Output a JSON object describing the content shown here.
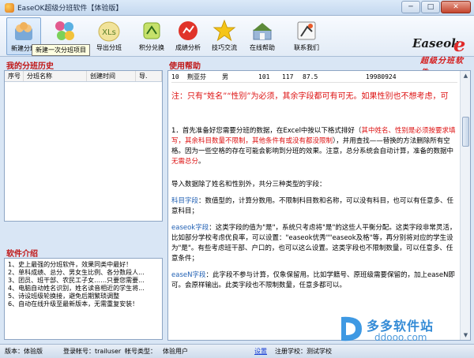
{
  "window": {
    "title": "EaseOK超级分班软件【体验版】",
    "controls": [
      "─",
      "□",
      "✕"
    ]
  },
  "toolbar": {
    "items": [
      {
        "label": "新建分班",
        "icon": "new-class-icon"
      },
      {
        "label": "",
        "icon": "open-bubbles-icon"
      },
      {
        "label": "导出分班",
        "icon": "xls-export-icon"
      },
      {
        "label": "积分兑换",
        "icon": "points-exchange-icon"
      },
      {
        "label": "成绩分析",
        "icon": "grade-analysis-icon"
      },
      {
        "label": "技巧交流",
        "icon": "star-tips-icon"
      },
      {
        "label": "在线帮助",
        "icon": "online-help-icon"
      },
      {
        "label": "联系我们",
        "icon": "contact-icon"
      }
    ],
    "tooltip": "新建一次分班项目"
  },
  "brand": {
    "name": "Easeok",
    "mark": "e",
    "tagline": "超级分班软件"
  },
  "history": {
    "heading": "我的分班历史",
    "columns": [
      "序号",
      "分班名称",
      "创建时间",
      "导."
    ]
  },
  "intro": {
    "heading": "软件介绍",
    "items": [
      "1、史上最强的分班软件，效果同类中最好！",
      "2、单科成绩、总分、男女生比例、各分数段人...",
      "3、团员、班干部、农民工子女……只要您需要...",
      "4、电脑自动姓名识别，姓名读音相近的学生将...",
      "5、诗设班级轮换接，避免后期繁琐调整",
      "6、自动在线升级至最新版本，无需重复安装！"
    ]
  },
  "help": {
    "heading": "使用帮助",
    "sample_row": [
      "10",
      "荆亚芬",
      "男",
      "101",
      "117",
      "87.5",
      "19980924"
    ],
    "note": "注：只有“姓名”“性别”为必须，其余字段都可有可无。如果性别也不想考虑，可",
    "p1_a": "1．首先准备好您需要分班的数据，在Excel中按以下格式排好（",
    "p1_red": "其中姓名、性别是必须按要求填写，其余科目数量不限制，其他条件有或没有都没限制",
    "p1_b": "），并用查找——替换的方法删除所有空格。因为一些空格的存在可能会影响到分班的效果。注意，总分系统会自动计算，准备的数据中",
    "p1_red2": "无需总分",
    "p1_c": "。",
    "p2": "导入数据除了姓名和性别外，共分三种类型的字段：",
    "p3_label": "科目字段",
    "p3": "：数值型的，计算分数用。不限制科目数和名称，可以没有科目，也可以有任意多、任意科目；",
    "p4_label": "easeok字段",
    "p4": "：这类字段的值为\"是\"，系统只考虑将\"是\"的这些人平衡分配。这类字段非常灵活，比如部分学校考虑优良率，可以设置：\"easeok优秀\"\"easeok及格\"等，再分别将对应的学生设为\"是\"。有些考虑班干部、户口的，也可以这么设置。这类字段也不限制数量，可以任意多、任意条件；",
    "p5_label": "easeN字段",
    "p5": "：此字段不参与计算，仅象保留用。比如学籍号、原班级需要保留的，加上easeN即可。会原样输出。此类字段也不限制数量，任意多都可以。"
  },
  "status": {
    "version": "版本：体验版",
    "account": "登录帐号：trailuser",
    "account_type": "帐号类型：",
    "account_type_value": "体验用户",
    "settings_link": "设置",
    "school": "注册学校：测试学校"
  },
  "watermark": {
    "line1": "多多软件站",
    "line2": "ddooo.com"
  }
}
